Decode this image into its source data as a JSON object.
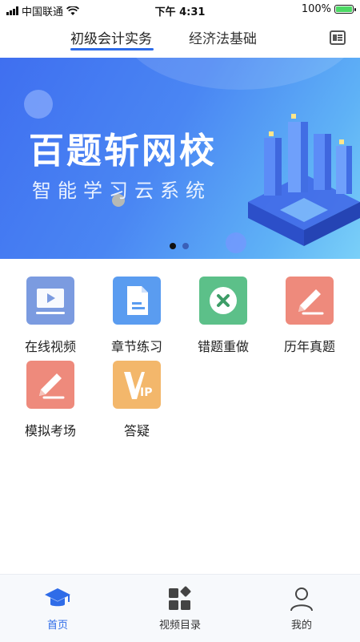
{
  "status_bar": {
    "carrier": "中国联通",
    "time": "下午 4:31",
    "battery": "100%"
  },
  "top_tabs": [
    {
      "label": "初级会计实务",
      "active": true
    },
    {
      "label": "经济法基础",
      "active": false
    }
  ],
  "banner": {
    "title": "百题斩网校",
    "subtitle": "智能学习云系统",
    "slide_count": 2,
    "active_slide": 1
  },
  "features": [
    {
      "label": "在线视频",
      "icon": "video-icon",
      "color": "#7b9be0"
    },
    {
      "label": "章节练习",
      "icon": "document-icon",
      "color": "#5a9cf0"
    },
    {
      "label": "错题重做",
      "icon": "cross-circle-icon",
      "color": "#5cc089"
    },
    {
      "label": "历年真题",
      "icon": "pencil-icon",
      "color": "#ee8a7c"
    },
    {
      "label": "模拟考场",
      "icon": "pencil-icon",
      "color": "#ee8a7c"
    },
    {
      "label": "答疑",
      "icon": "vip-icon",
      "color": "#f3b76b"
    }
  ],
  "bottom_nav": [
    {
      "label": "首页",
      "icon": "graduation-cap-icon",
      "active": true
    },
    {
      "label": "视频目录",
      "icon": "grid-icon",
      "active": false
    },
    {
      "label": "我的",
      "icon": "user-icon",
      "active": false
    }
  ],
  "colors": {
    "accent": "#2f6ce8",
    "banner_start": "#3f6ff0",
    "banner_end": "#7ad0f8"
  }
}
